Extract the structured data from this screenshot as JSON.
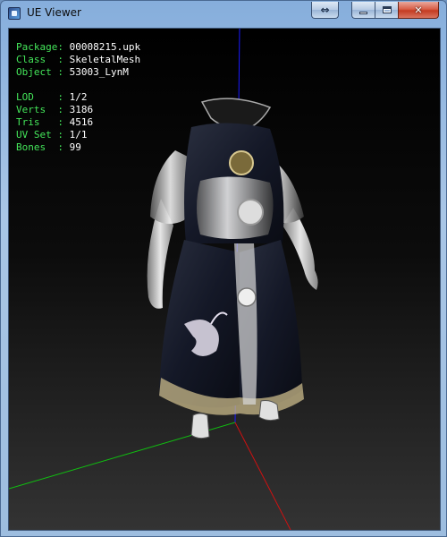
{
  "window": {
    "title": "UE Viewer"
  },
  "titlebar_buttons": {
    "swap_icon": "swap-arrows-icon",
    "swap_glyph": "⇔",
    "close_glyph": "✕"
  },
  "info": {
    "package": {
      "label": "Package:",
      "value": "00008215.upk"
    },
    "class": {
      "label": "Class  :",
      "value": "SkeletalMesh"
    },
    "object": {
      "label": "Object :",
      "value": "53003_LynM"
    },
    "lod": {
      "label": "LOD    :",
      "value": "1/2"
    },
    "verts": {
      "label": "Verts  :",
      "value": "3186"
    },
    "tris": {
      "label": "Tris   :",
      "value": "4516"
    },
    "uvset": {
      "label": "UV Set :",
      "value": "1/1"
    },
    "bones": {
      "label": "Bones  :",
      "value": "99"
    }
  },
  "colors": {
    "label_green": "#44e65a",
    "axis_x": "#d01010",
    "axis_y": "#10c010",
    "axis_z": "#1a1aff"
  }
}
